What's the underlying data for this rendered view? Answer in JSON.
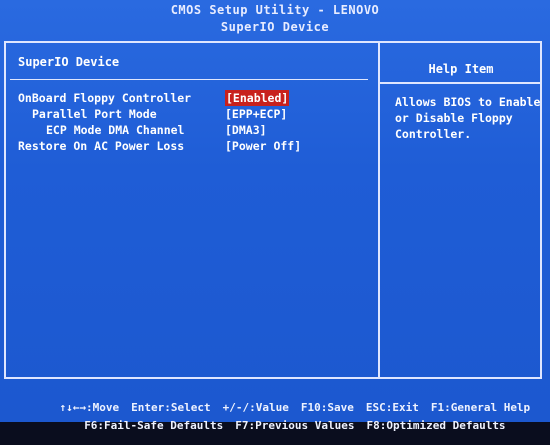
{
  "header": {
    "utility_title": "CMOS Setup Utility - LENOVO",
    "page_title": "SuperIO Device"
  },
  "section": {
    "title": "SuperIO Device"
  },
  "settings": [
    {
      "label": "OnBoard Floppy Controller",
      "value": "[Enabled]",
      "indent": 0,
      "selected": true
    },
    {
      "label": "Parallel Port Mode",
      "value": "[EPP+ECP]",
      "indent": 1,
      "selected": false
    },
    {
      "label": "ECP Mode DMA Channel",
      "value": "[DMA3]",
      "indent": 2,
      "selected": false
    },
    {
      "label": "Restore On AC Power Loss",
      "value": "[Power Off]",
      "indent": 0,
      "selected": false
    }
  ],
  "help": {
    "title": "Help Item",
    "lines": [
      "Allows BIOS to Enable",
      "or Disable Floppy",
      "Controller."
    ]
  },
  "footer": {
    "line1": [
      "↑↓←→:Move",
      "Enter:Select",
      "+/-/:Value",
      "F10:Save",
      "ESC:Exit",
      "F1:General Help"
    ],
    "line2": [
      "F6:Fail-Safe Defaults",
      "F7:Previous Values",
      "F8:Optimized Defaults"
    ]
  },
  "colors": {
    "background": "#1f5dd6",
    "highlight": "#c8211d",
    "text": "#ffffff"
  }
}
